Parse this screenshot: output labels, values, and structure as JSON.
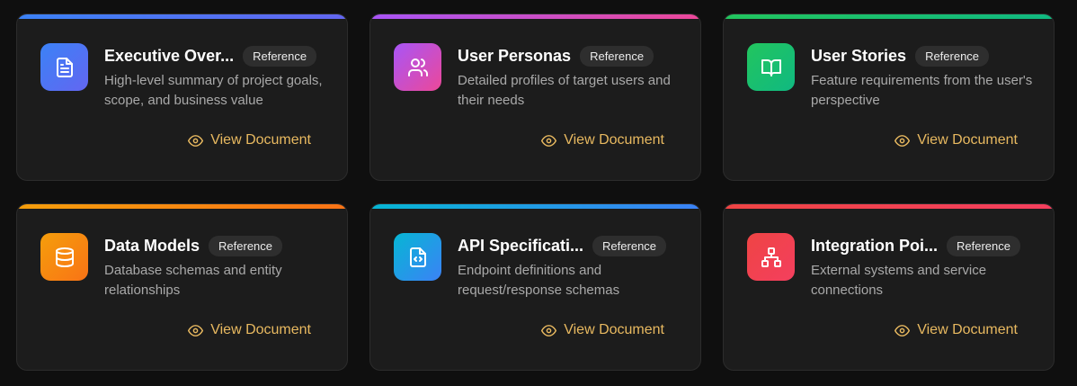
{
  "cards": [
    {
      "title": "Executive Over...",
      "badge": "Reference",
      "description": "High-level summary of project goals, scope, and business value",
      "action": "View Document",
      "icon": "file-text-icon",
      "bar_color": "linear-gradient(90deg,#3b82f6,#6366f1)",
      "tile_color": "linear-gradient(135deg,#3b82f6,#6366f1)"
    },
    {
      "title": "User Personas",
      "badge": "Reference",
      "description": "Detailed profiles of target users and their needs",
      "action": "View Document",
      "icon": "users-icon",
      "bar_color": "linear-gradient(90deg,#a855f7,#ec4899)",
      "tile_color": "linear-gradient(135deg,#a855f7,#ec4899)"
    },
    {
      "title": "User Stories",
      "badge": "Reference",
      "description": "Feature requirements from the user's perspective",
      "action": "View Document",
      "icon": "book-open-icon",
      "bar_color": "linear-gradient(90deg,#22c55e,#10b981)",
      "tile_color": "linear-gradient(135deg,#22c55e,#10b981)"
    },
    {
      "title": "Data Models",
      "badge": "Reference",
      "description": "Database schemas and entity relationships",
      "action": "View Document",
      "icon": "database-icon",
      "bar_color": "linear-gradient(90deg,#f59e0b,#f97316)",
      "tile_color": "linear-gradient(135deg,#f59e0b,#f97316)"
    },
    {
      "title": "API Specificati...",
      "badge": "Reference",
      "description": "Endpoint definitions and request/response schemas",
      "action": "View Document",
      "icon": "file-code-icon",
      "bar_color": "linear-gradient(90deg,#06b6d4,#3b82f6)",
      "tile_color": "linear-gradient(135deg,#06b6d4,#3b82f6)"
    },
    {
      "title": "Integration Poi...",
      "badge": "Reference",
      "description": "External systems and service connections",
      "action": "View Document",
      "icon": "network-icon",
      "bar_color": "linear-gradient(90deg,#ef4444,#f43f5e)",
      "tile_color": "linear-gradient(135deg,#ef4444,#f43f5e)"
    }
  ]
}
